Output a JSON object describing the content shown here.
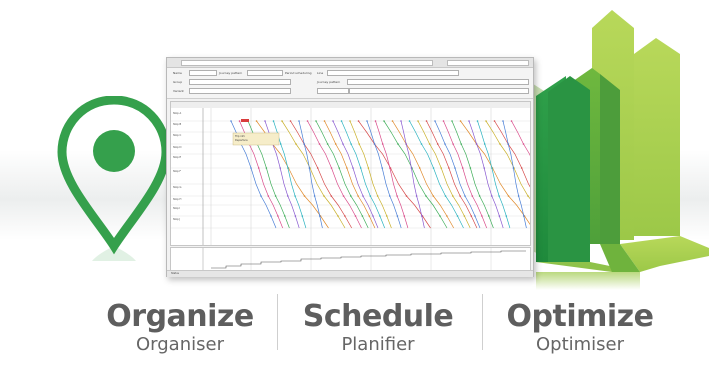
{
  "window": {
    "toolbar": {
      "row1": [
        "Name",
        "Journey pattern",
        "Period scheduling",
        "Line"
      ],
      "row2": [
        "Group",
        "Journey pattern"
      ],
      "row3": [
        "Variant"
      ]
    },
    "gantt_labels": [
      "Stop A",
      "Stop B",
      "Stop C",
      "Stop D",
      "Stop E",
      "Stop F",
      "Stop G",
      "Stop H",
      "Stop I",
      "Stop J"
    ],
    "tooltip_lines": [
      "Trip info",
      "Departure",
      "Arrival"
    ],
    "status_text": "Status"
  },
  "captions": [
    {
      "main": "Organize",
      "sub": "Organiser"
    },
    {
      "main": "Schedule",
      "sub": "Planifier"
    },
    {
      "main": "Optimize",
      "sub": "Optimiser"
    }
  ],
  "colors": {
    "green_dark": "#2e9a48",
    "green_mid": "#55ae3c",
    "green_light": "#a6cf4e",
    "caption_text": "#5e5e5e"
  },
  "icons": [
    "location-pin-icon",
    "bar-chart-graphic"
  ]
}
